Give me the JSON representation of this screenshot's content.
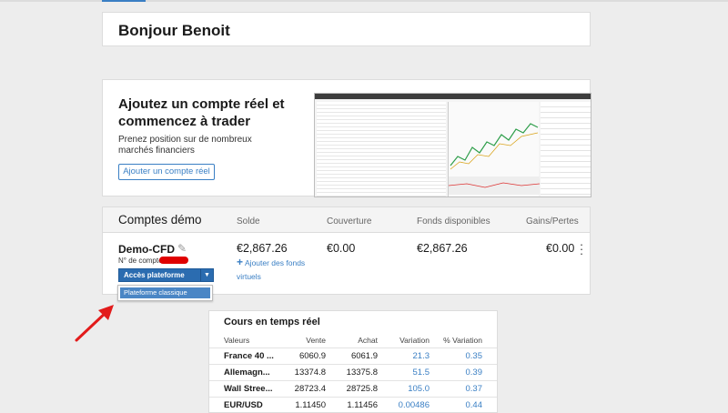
{
  "greeting": "Bonjour Benoit",
  "promo": {
    "title": "Ajoutez un compte réel et commencez à trader",
    "subtitle": "Prenez position sur de nombreux marchés financiers",
    "button": "Ajouter un compte réel"
  },
  "demo": {
    "title": "Comptes démo",
    "columns": {
      "balance": "Solde",
      "coverage": "Couverture",
      "available": "Fonds disponibles",
      "pnl": "Gains/Pertes"
    },
    "account": {
      "name": "Demo-CFD",
      "number_label": "N° de compte",
      "balance": "€2,867.26",
      "coverage": "€0.00",
      "available": "€2,867.26",
      "pnl": "€0.00",
      "add_funds": "Ajouter des fonds virtuels",
      "access_button": "Accès plateforme",
      "dropdown_option": "Plateforme classique"
    }
  },
  "quotes": {
    "title": "Cours en temps réel",
    "headers": {
      "name": "Valeurs",
      "sell": "Vente",
      "buy": "Achat",
      "change": "Variation",
      "pct": "% Variation"
    },
    "rows": [
      {
        "name": "France 40 ...",
        "sell": "6060.9",
        "buy": "6061.9",
        "change": "21.3",
        "pct": "0.35"
      },
      {
        "name": "Allemagn...",
        "sell": "13374.8",
        "buy": "13375.8",
        "change": "51.5",
        "pct": "0.39"
      },
      {
        "name": "Wall Stree...",
        "sell": "28723.4",
        "buy": "28725.8",
        "change": "105.0",
        "pct": "0.37"
      },
      {
        "name": "EUR/USD",
        "sell": "1.11450",
        "buy": "1.11456",
        "change": "0.00486",
        "pct": "0.44"
      }
    ]
  },
  "colors": {
    "accent": "#3a7fc4",
    "arrow": "#e21b1b",
    "redaction": "#e00000"
  }
}
